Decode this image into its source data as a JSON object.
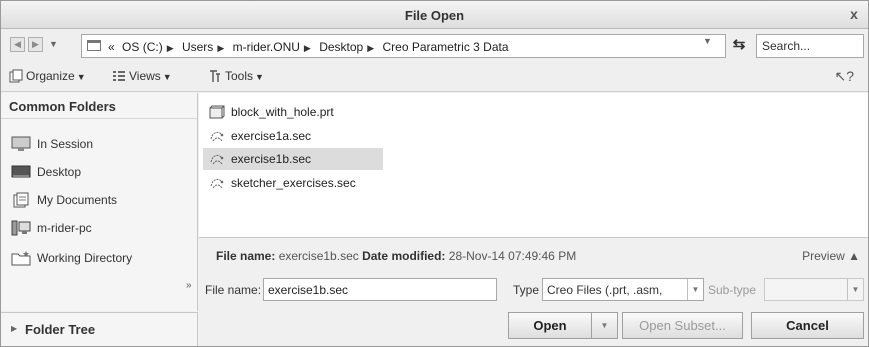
{
  "window": {
    "title": "File Open",
    "close_glyph": "x"
  },
  "address_bar": {
    "breadcrumb_prefix": "«",
    "crumbs": [
      "OS (C:)",
      "Users",
      "m-rider.ONU",
      "Desktop",
      "Creo Parametric 3 Data"
    ],
    "search_placeholder": "Search..."
  },
  "toolbar": {
    "organize_label": "Organize",
    "views_label": "Views",
    "tools_label": "Tools"
  },
  "sidebar": {
    "heading": "Common Folders",
    "items": [
      {
        "label": "In Session",
        "icon": "monitor-icon"
      },
      {
        "label": "Desktop",
        "icon": "desktop-icon"
      },
      {
        "label": "My Documents",
        "icon": "documents-icon"
      },
      {
        "label": "m-rider-pc",
        "icon": "computer-icon"
      },
      {
        "label": "Working Directory",
        "icon": "folder-star-icon"
      }
    ],
    "more_glyph": "»",
    "folder_tree_label": "Folder Tree"
  },
  "files": [
    {
      "name": "block_with_hole.prt",
      "icon": "part-icon",
      "selected": false
    },
    {
      "name": "exercise1a.sec",
      "icon": "sketch-icon",
      "selected": false
    },
    {
      "name": "exercise1b.sec",
      "icon": "sketch-icon",
      "selected": true
    },
    {
      "name": "sketcher_exercises.sec",
      "icon": "sketch-icon",
      "selected": false
    }
  ],
  "info": {
    "file_name_label": "File name:",
    "file_name_value": "exercise1b.sec",
    "date_label": "Date modified:",
    "date_value": "28-Nov-14 07:49:46 PM",
    "preview_label": "Preview ▲"
  },
  "bottom": {
    "file_name_label": "File name:",
    "file_name_value": "exercise1b.sec",
    "type_label": "Type",
    "type_value": "Creo Files (.prt, .asm,",
    "subtype_label": "Sub-type",
    "subtype_value": ""
  },
  "buttons": {
    "open": "Open",
    "open_subset": "Open Subset...",
    "cancel": "Cancel"
  }
}
